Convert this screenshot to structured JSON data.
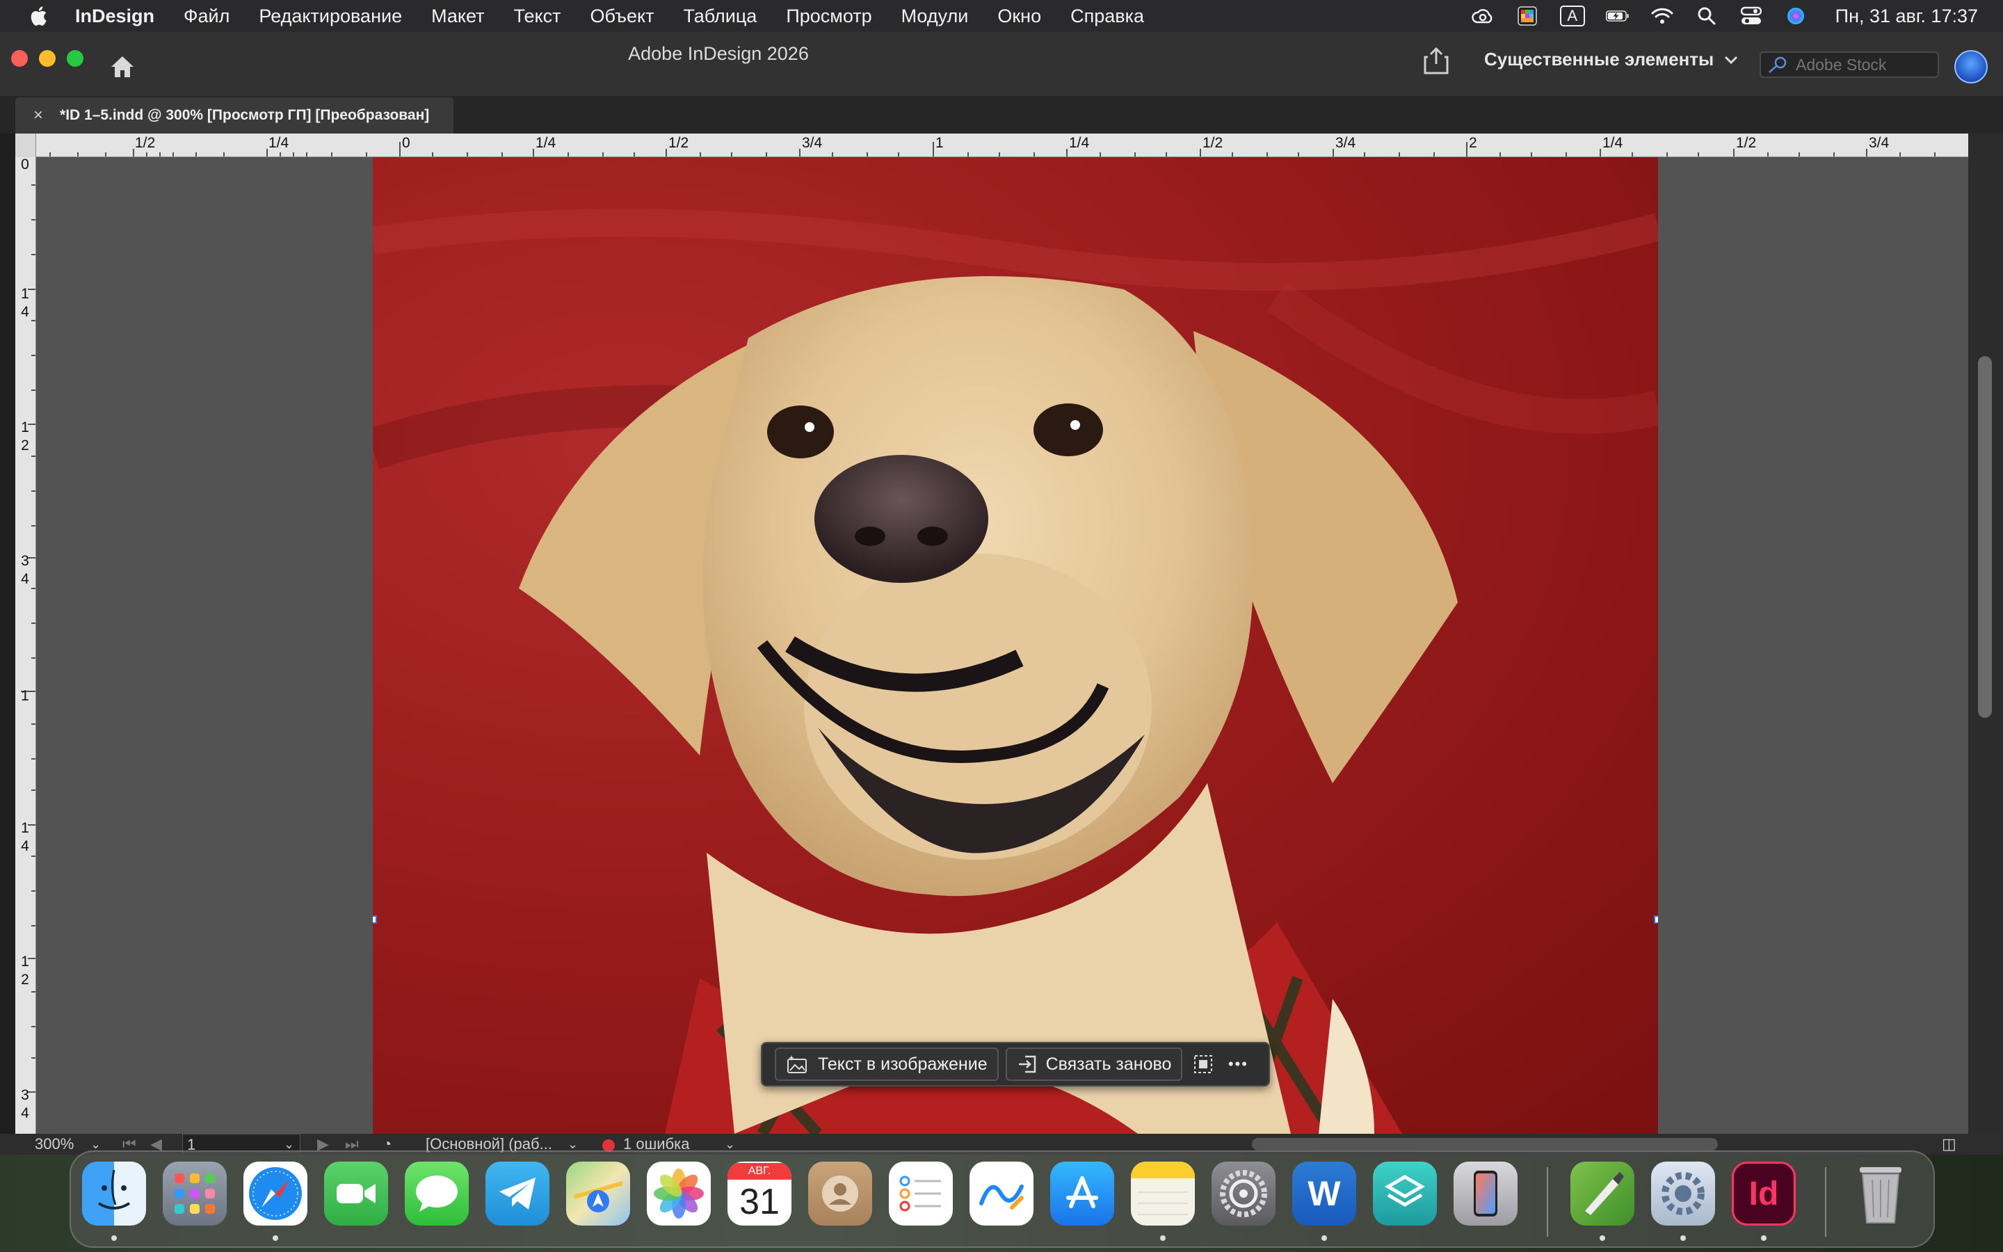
{
  "menubar": {
    "app_name": "InDesign",
    "items": [
      "Файл",
      "Редактирование",
      "Макет",
      "Текст",
      "Объект",
      "Таблица",
      "Просмотр",
      "Модули",
      "Окно",
      "Справка"
    ],
    "input_indicator": "A",
    "datetime": "Пн, 31 авг.  17:37"
  },
  "window": {
    "title": "Adobe InDesign 2026",
    "workspace_label": "Существенные элементы",
    "stock_placeholder": "Adobe Stock"
  },
  "document_tab": {
    "close_glyph": "×",
    "label": "*ID 1–5.indd @ 300% [Просмотр ГП] [Преобразован]"
  },
  "ruler": {
    "horizontal_labels": [
      "1/2",
      "1/4",
      "0",
      "1/4",
      "1/2",
      "3/4",
      "1",
      "1/4",
      "1/2",
      "3/4",
      "2",
      "1/4",
      "1/2",
      "3/4"
    ],
    "vertical_labels": [
      "0",
      "1 4",
      "1 2",
      "3 4",
      "1",
      "1 4",
      "1 2",
      "3 4"
    ]
  },
  "task_bar": {
    "text_in_image_label": "Текст в изображение",
    "relink_label": "Связать заново",
    "more_glyph": "•••"
  },
  "status_bar": {
    "zoom": "300%",
    "page": "1",
    "master": "[Основной] (раб...",
    "errors": "1 ошибка"
  },
  "dock": {
    "calendar_month": "АВГ.",
    "calendar_day": "31",
    "indesign_label": "Id",
    "word_label": "W",
    "apps": [
      "finder",
      "launchpad",
      "safari",
      "facetime",
      "messages",
      "telegram",
      "maps",
      "photos",
      "calendar",
      "contacts",
      "reminders",
      "freeform",
      "app-store",
      "notes",
      "system-settings",
      "word",
      "shortcuts",
      "iphone-mirroring",
      "pen-app",
      "settings-gear",
      "indesign",
      "trash"
    ]
  },
  "colors": {
    "accent": "#3b6fd8",
    "error": "#e0343a",
    "indesign": "#ff3366"
  }
}
